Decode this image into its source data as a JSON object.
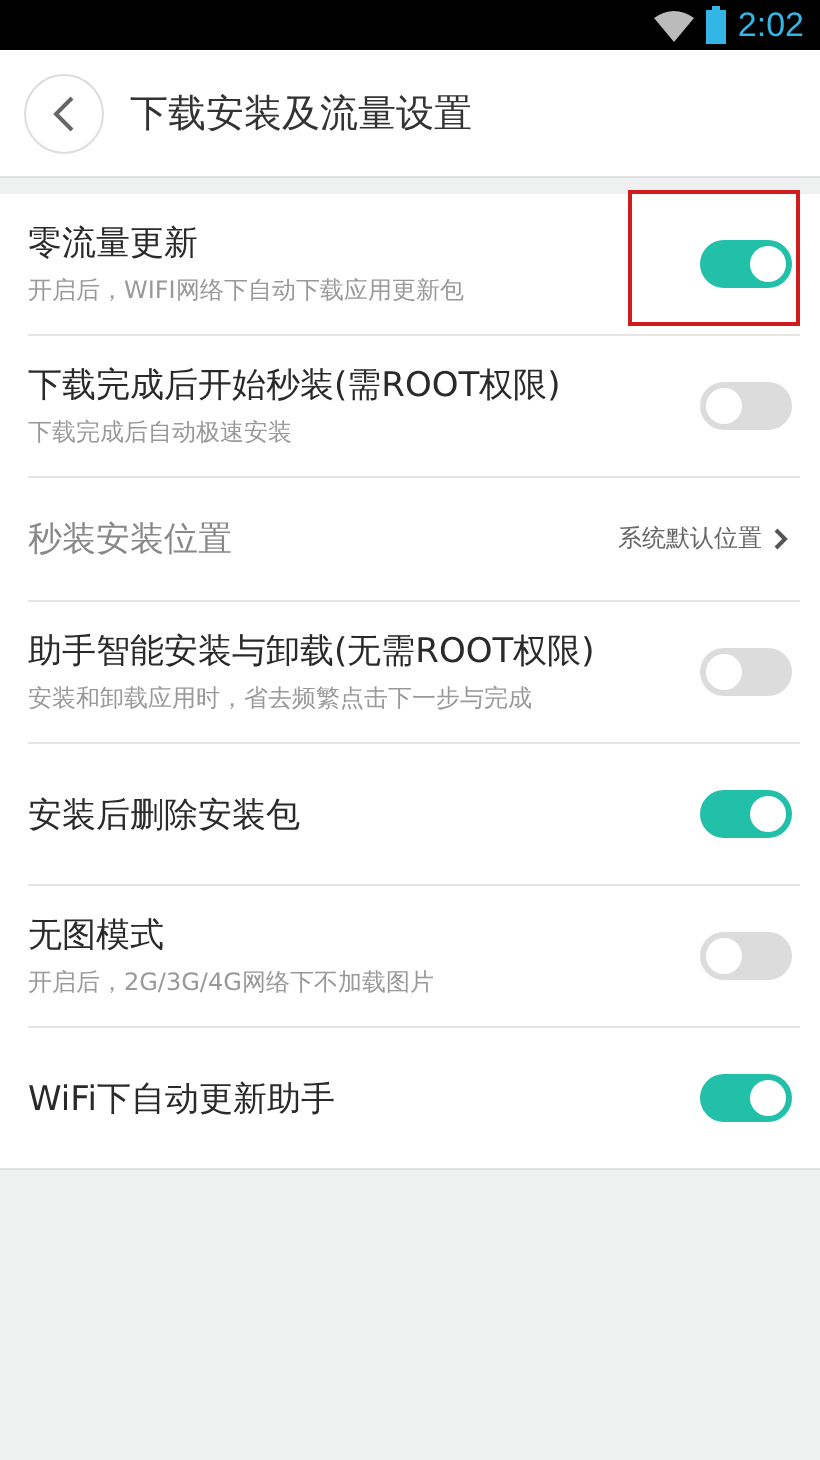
{
  "status_bar": {
    "time": "2:02"
  },
  "header": {
    "title": "下载安装及流量设置"
  },
  "settings": [
    {
      "kind": "toggle",
      "title": "零流量更新",
      "subtitle": "开启后，WIFI网络下自动下载应用更新包",
      "on": true,
      "highlighted": true
    },
    {
      "kind": "toggle",
      "title": "下载完成后开始秒装(需ROOT权限)",
      "subtitle": "下载完成后自动极速安装",
      "on": false,
      "highlighted": false
    },
    {
      "kind": "nav",
      "title": "秒装安装位置",
      "value": "系统默认位置",
      "disabled": true
    },
    {
      "kind": "toggle",
      "title": "助手智能安装与卸载(无需ROOT权限)",
      "subtitle": "安装和卸载应用时，省去频繁点击下一步与完成",
      "on": false,
      "highlighted": false
    },
    {
      "kind": "toggle",
      "title": "安装后删除安装包",
      "on": true,
      "highlighted": false
    },
    {
      "kind": "toggle",
      "title": "无图模式",
      "subtitle": "开启后，2G/3G/4G网络下不加载图片",
      "on": false,
      "highlighted": false
    },
    {
      "kind": "toggle",
      "title": "WiFi下自动更新助手",
      "on": true,
      "highlighted": false
    }
  ]
}
